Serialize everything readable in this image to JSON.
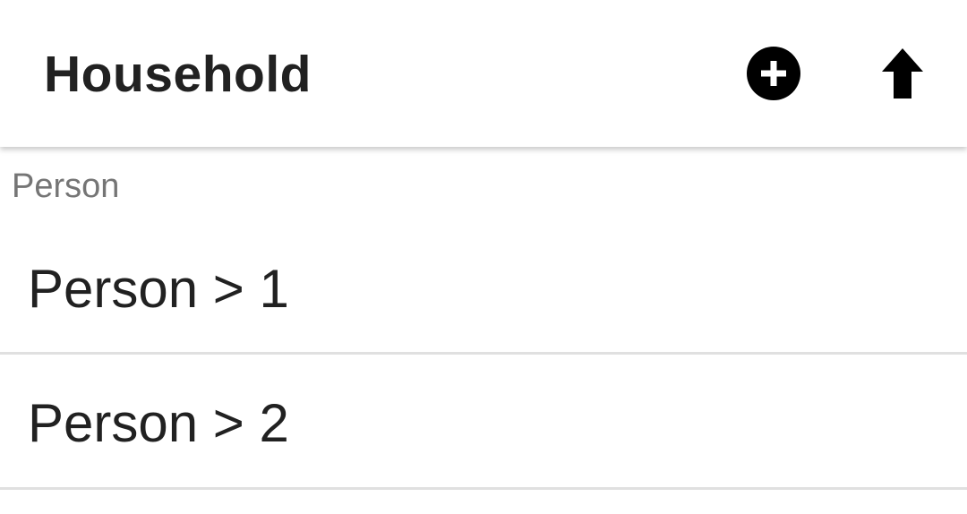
{
  "toolbar": {
    "title": "Household",
    "add_icon": "add-circle-icon",
    "upload_icon": "upload-arrow-icon"
  },
  "section": {
    "header": "Person"
  },
  "list": {
    "items": [
      {
        "label": "Person > 1"
      },
      {
        "label": "Person > 2"
      }
    ]
  },
  "colors": {
    "title_text": "#212121",
    "section_text": "#757575",
    "divider": "#e0e0e0",
    "icon": "#000000"
  }
}
